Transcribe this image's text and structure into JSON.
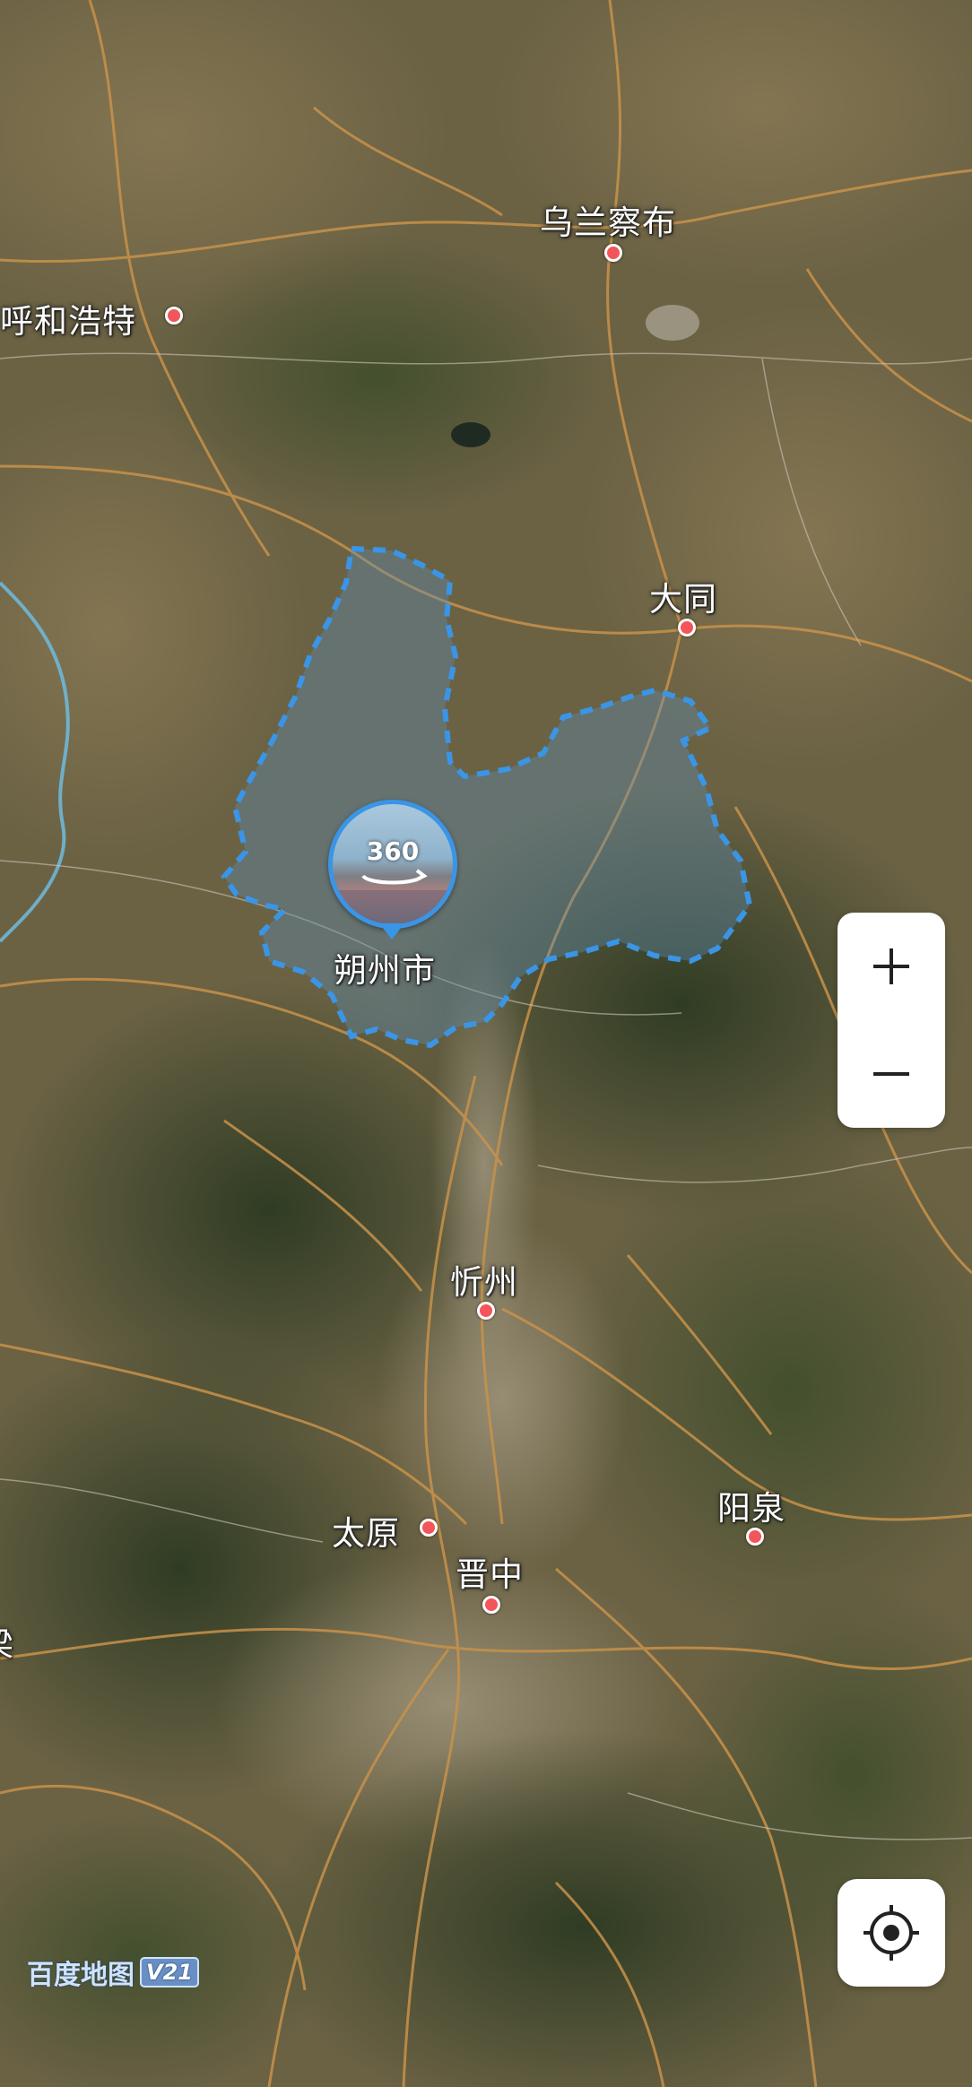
{
  "map": {
    "type": "satellite",
    "highlighted_region": "朔州市",
    "colors": {
      "boundary": "#3a95e6",
      "city_dot": "#f2555a",
      "road": "#c9924a"
    }
  },
  "cities": {
    "wulanchabu": "乌兰察布",
    "huhehaote": "呼和浩特",
    "datong": "大同",
    "shuozhou": "朔州市",
    "xinzhou": "忻州",
    "taiyuan": "太原",
    "jinzhong": "晋中",
    "yangquan": "阳泉",
    "partial_left": "梁"
  },
  "panorama": {
    "label": "360",
    "icon": "panorama-360-icon"
  },
  "controls": {
    "zoom_in_icon": "plus-icon",
    "zoom_out_icon": "minus-icon",
    "locate_icon": "crosshair-locate-icon"
  },
  "logo": {
    "name": "百度地图",
    "version": "V21"
  }
}
